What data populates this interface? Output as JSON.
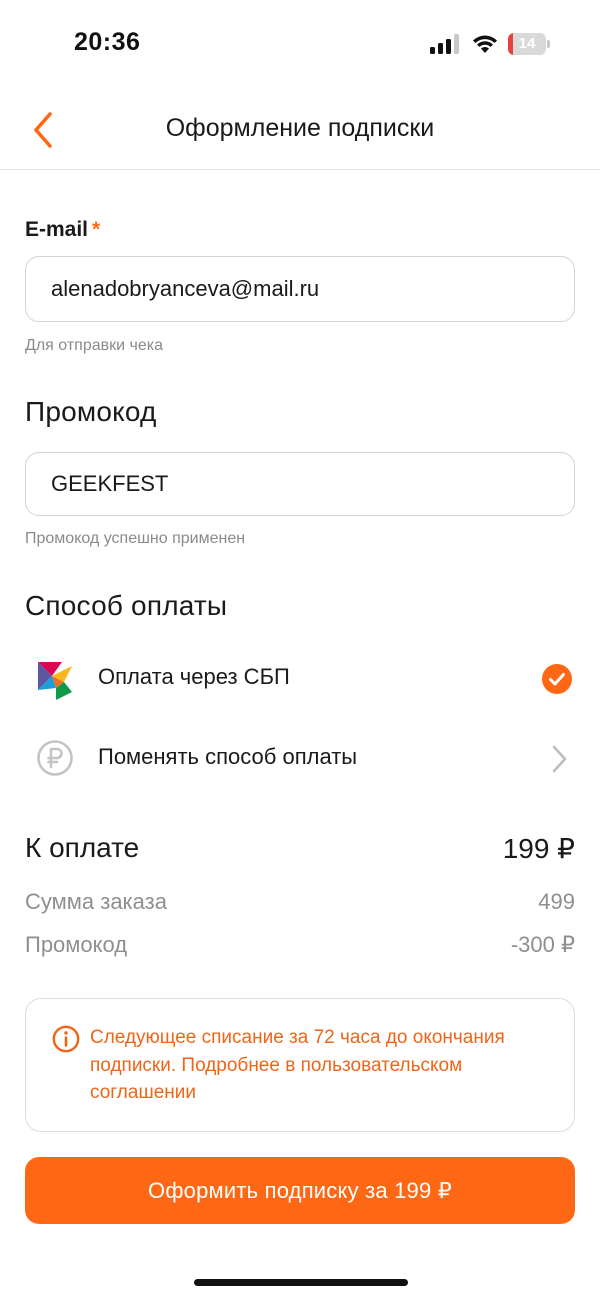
{
  "status_bar": {
    "time": "20:36",
    "battery_level": "14",
    "battery_fraction": 0.14,
    "battery_color": "#e8403c",
    "icons": [
      "signal-icon",
      "wifi-icon",
      "battery-icon"
    ]
  },
  "header": {
    "title": "Оформление подписки",
    "back_icon": "chevron-left-icon"
  },
  "email": {
    "label": "E-mail",
    "required_mark": "*",
    "value": "alenadobryanceva@mail.ru",
    "hint": "Для отправки чека"
  },
  "promo": {
    "title": "Промокод",
    "value": "GEEKFEST",
    "hint": "Промокод успешно применен"
  },
  "payment": {
    "title": "Способ оплаты",
    "methods": [
      {
        "label": "Оплата через СБП",
        "icon": "sbp-logo-icon",
        "selected": true,
        "trailing_icon": "check-circle-icon"
      },
      {
        "label": "Поменять способ оплаты",
        "icon": "ruble-coin-icon",
        "selected": false,
        "trailing_icon": "chevron-right-icon"
      }
    ]
  },
  "summary": {
    "total_label": "К оплате",
    "total_value": "199 ₽",
    "rows": [
      {
        "label": "Сумма заказа",
        "value": "499"
      },
      {
        "label": "Промокод",
        "value": "-300 ₽"
      }
    ]
  },
  "notice": {
    "icon": "info-icon",
    "text": "Следующее списание за 72 часа до окончания подписки. Подробнее в пользовательском соглашении"
  },
  "cta": {
    "label": "Оформить подписку за 199 ₽"
  },
  "colors": {
    "accent": "#fe6814",
    "notice_text": "#f06418",
    "muted_text": "#8f8f8f"
  }
}
